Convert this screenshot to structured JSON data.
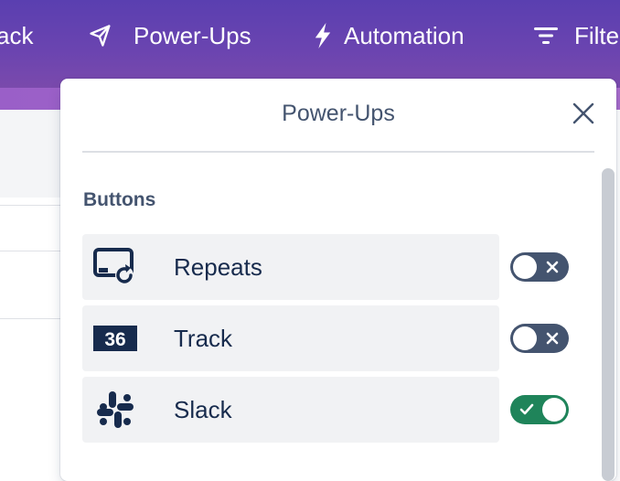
{
  "header": {
    "back_label": "ack",
    "powerups_label": "Power-Ups",
    "automation_label": "Automation",
    "filter_label": "Filte"
  },
  "popover": {
    "title": "Power-Ups",
    "section_heading": "Buttons",
    "items": [
      {
        "label": "Repeats",
        "icon": "repeat-card-icon",
        "enabled": false
      },
      {
        "label": "Track",
        "icon": "calendar-36-icon",
        "badge_text": "36",
        "enabled": false
      },
      {
        "label": "Slack",
        "icon": "slack-icon",
        "enabled": true
      }
    ]
  },
  "colors": {
    "header_gradient_top": "#5a3fb0",
    "header_gradient_bottom": "#7b4aac",
    "toggle_off": "#44546f",
    "toggle_on": "#1f845a",
    "icon_dark": "#172b4d",
    "row_bg": "#f1f2f4"
  }
}
